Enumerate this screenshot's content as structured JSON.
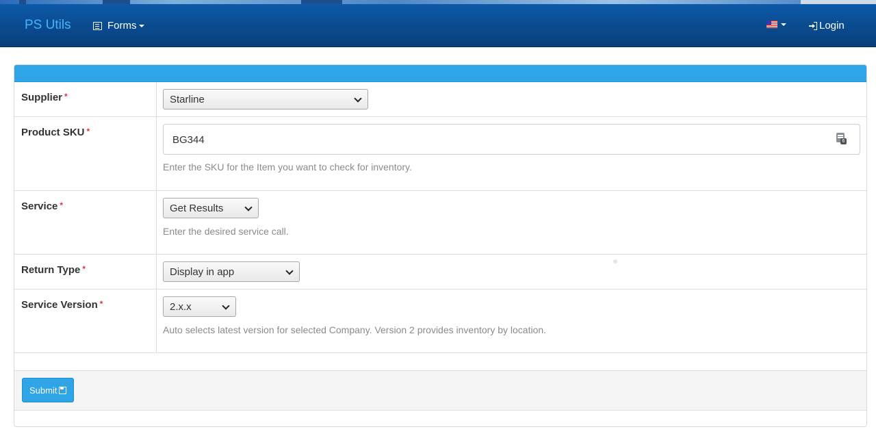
{
  "navbar": {
    "brand": "PS Utils",
    "forms_label": "Forms",
    "login_label": "Login",
    "language_flag": "us-flag-icon"
  },
  "form": {
    "supplier": {
      "label": "Supplier",
      "required": "*",
      "value": "Starline"
    },
    "product_sku": {
      "label": "Product SKU",
      "required": "*",
      "value": "BG344",
      "help": "Enter the SKU for the Item you want to check for inventory."
    },
    "service": {
      "label": "Service",
      "required": "*",
      "value": "Get Results",
      "help": "Enter the desired service call."
    },
    "return_type": {
      "label": "Return Type",
      "required": "*",
      "value": "Display in app"
    },
    "service_version": {
      "label": "Service Version",
      "required": "*",
      "value": "2.x.x",
      "help": "Auto selects latest version for selected Company. Version 2 provides inventory by location."
    }
  },
  "footer": {
    "submit_label": "Submit"
  },
  "colors": {
    "navbar": "#0a4a8e",
    "brand": "#45b4ff",
    "accent": "#2fa4e7",
    "required": "#d9363e"
  }
}
